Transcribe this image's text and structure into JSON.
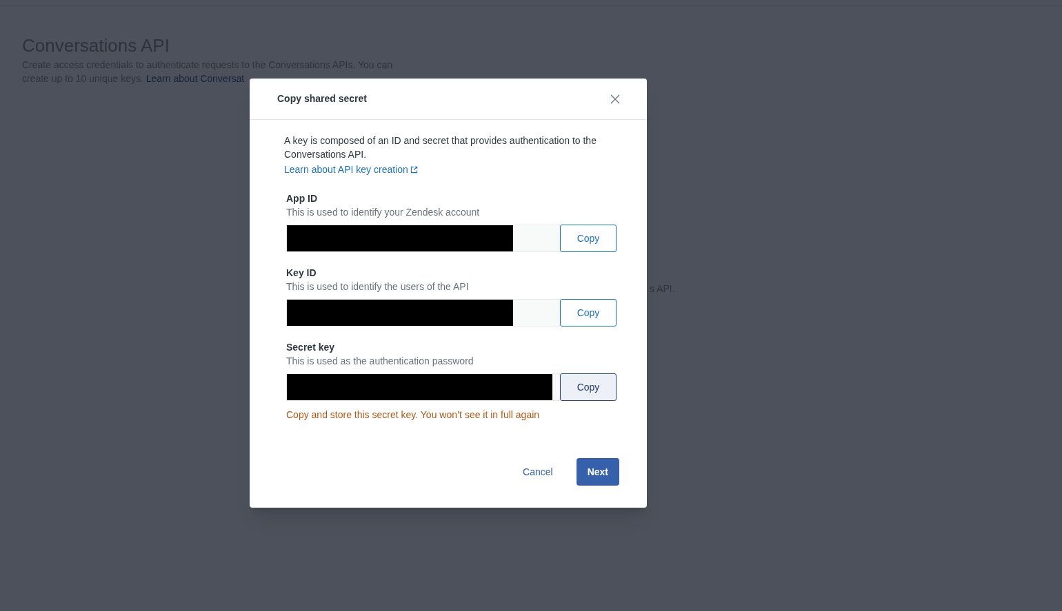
{
  "page": {
    "title": "Conversations API",
    "description": "Create access credentials to authenticate requests to the Conversations APIs. You can create up to 10 unique keys.",
    "link": "Learn about Conversat",
    "partial_text": "s API."
  },
  "modal": {
    "title": "Copy shared secret",
    "intro": "A key is composed of an ID and secret that provides authentication to the Conversations API.",
    "link": "Learn about API key creation",
    "fields": [
      {
        "label": "App ID",
        "hint": "This is used to identify your Zendesk account",
        "button": "Copy",
        "pressed": false,
        "level": 0.83
      },
      {
        "label": "Key ID",
        "hint": "This is used to identify the users of the API",
        "button": "Copy",
        "pressed": false,
        "level": 0.83
      },
      {
        "label": "Secret key",
        "hint": "This is used as the authentication password",
        "button": "Copy",
        "pressed": true,
        "level": 0.975
      }
    ],
    "warning": "Copy and store this secret key. You won’t see it in full again",
    "buttons": [
      {
        "label": "Cancel",
        "kind": "link"
      },
      {
        "label": "Next",
        "kind": "primary"
      }
    ]
  }
}
